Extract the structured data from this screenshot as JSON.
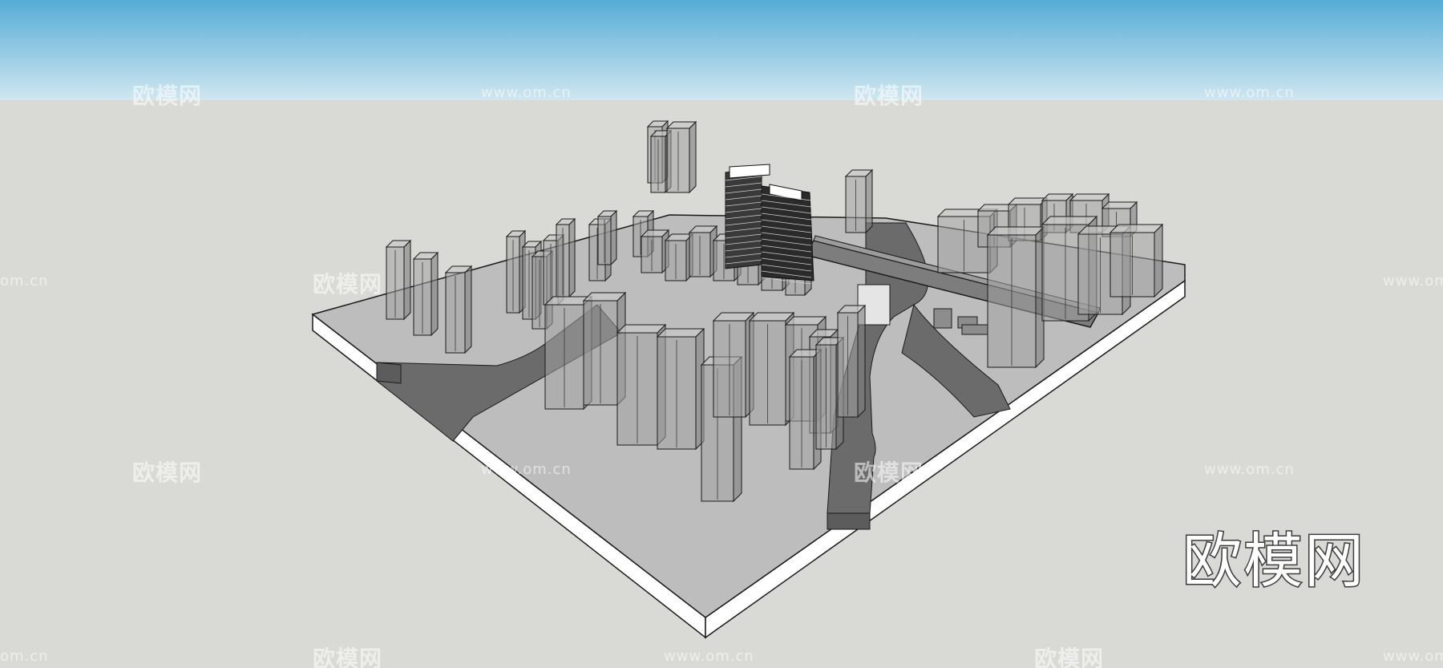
{
  "colors": {
    "sky_top": "#5aaed6",
    "sky_bottom": "#c7e4ef",
    "ground": "#d9d9d6",
    "site_top": "#b9b9b9",
    "site_side": "#ffffff",
    "road": "#6b6b6b",
    "building_glass": "#9a9a9a",
    "edge": "#1a1a1a"
  },
  "watermarks": {
    "brand": "欧模网",
    "url": "www.om.cn",
    "url_partial": "om.cn"
  },
  "logo": {
    "text": "欧模网"
  }
}
